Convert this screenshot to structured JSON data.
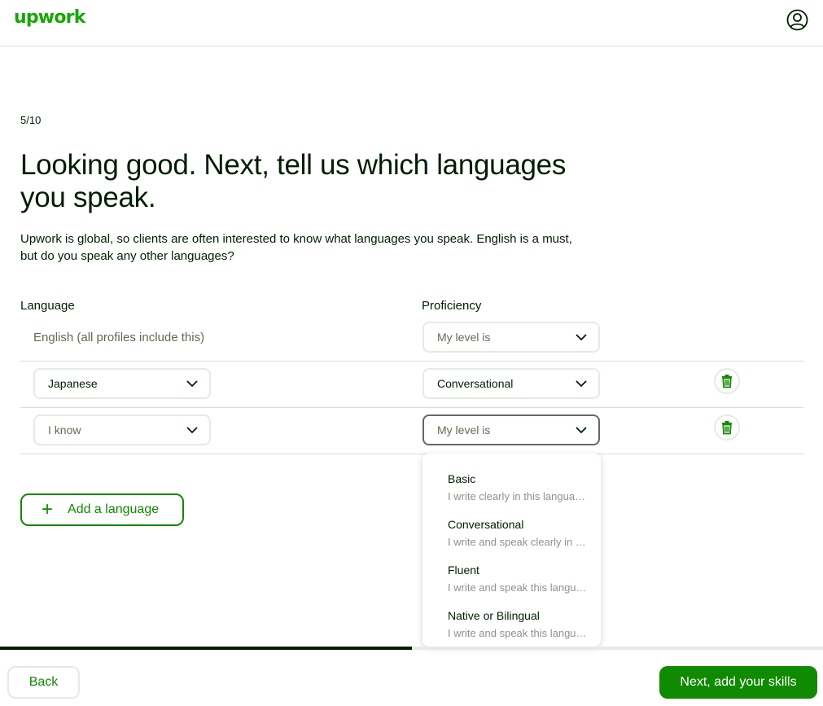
{
  "header": {
    "logo": "upwork",
    "avatar_icon": "user-circle-icon"
  },
  "step": "5/10",
  "heading": "Looking good. Next, tell us which languages you speak.",
  "description": "Upwork is global, so clients are often interested to know what languages you speak. English is a must, but do you speak any other languages?",
  "columns": {
    "language": "Language",
    "proficiency": "Proficiency"
  },
  "rows": [
    {
      "language": "English (all profiles include this)",
      "proficiency": "My level is"
    },
    {
      "language": "Japanese",
      "proficiency": "Conversational"
    },
    {
      "language": "I know",
      "proficiency": "My level is"
    }
  ],
  "add_language": "Add a language",
  "proficiency_options": [
    {
      "title": "Basic",
      "desc": "I write clearly in this language."
    },
    {
      "title": "Conversational",
      "desc": "I write and speak clearly in this language."
    },
    {
      "title": "Fluent",
      "desc": "I write and speak this language almost perfectly."
    },
    {
      "title": "Native or Bilingual",
      "desc": "I write and speak this language perfectly."
    }
  ],
  "progress": {
    "current": 5,
    "total": 10,
    "fraction": 0.5
  },
  "footer": {
    "back": "Back",
    "next": "Next, add your skills"
  },
  "colors": {
    "brand_green": "#14a800",
    "button_green": "#108a00",
    "text_dark": "#001e00"
  }
}
